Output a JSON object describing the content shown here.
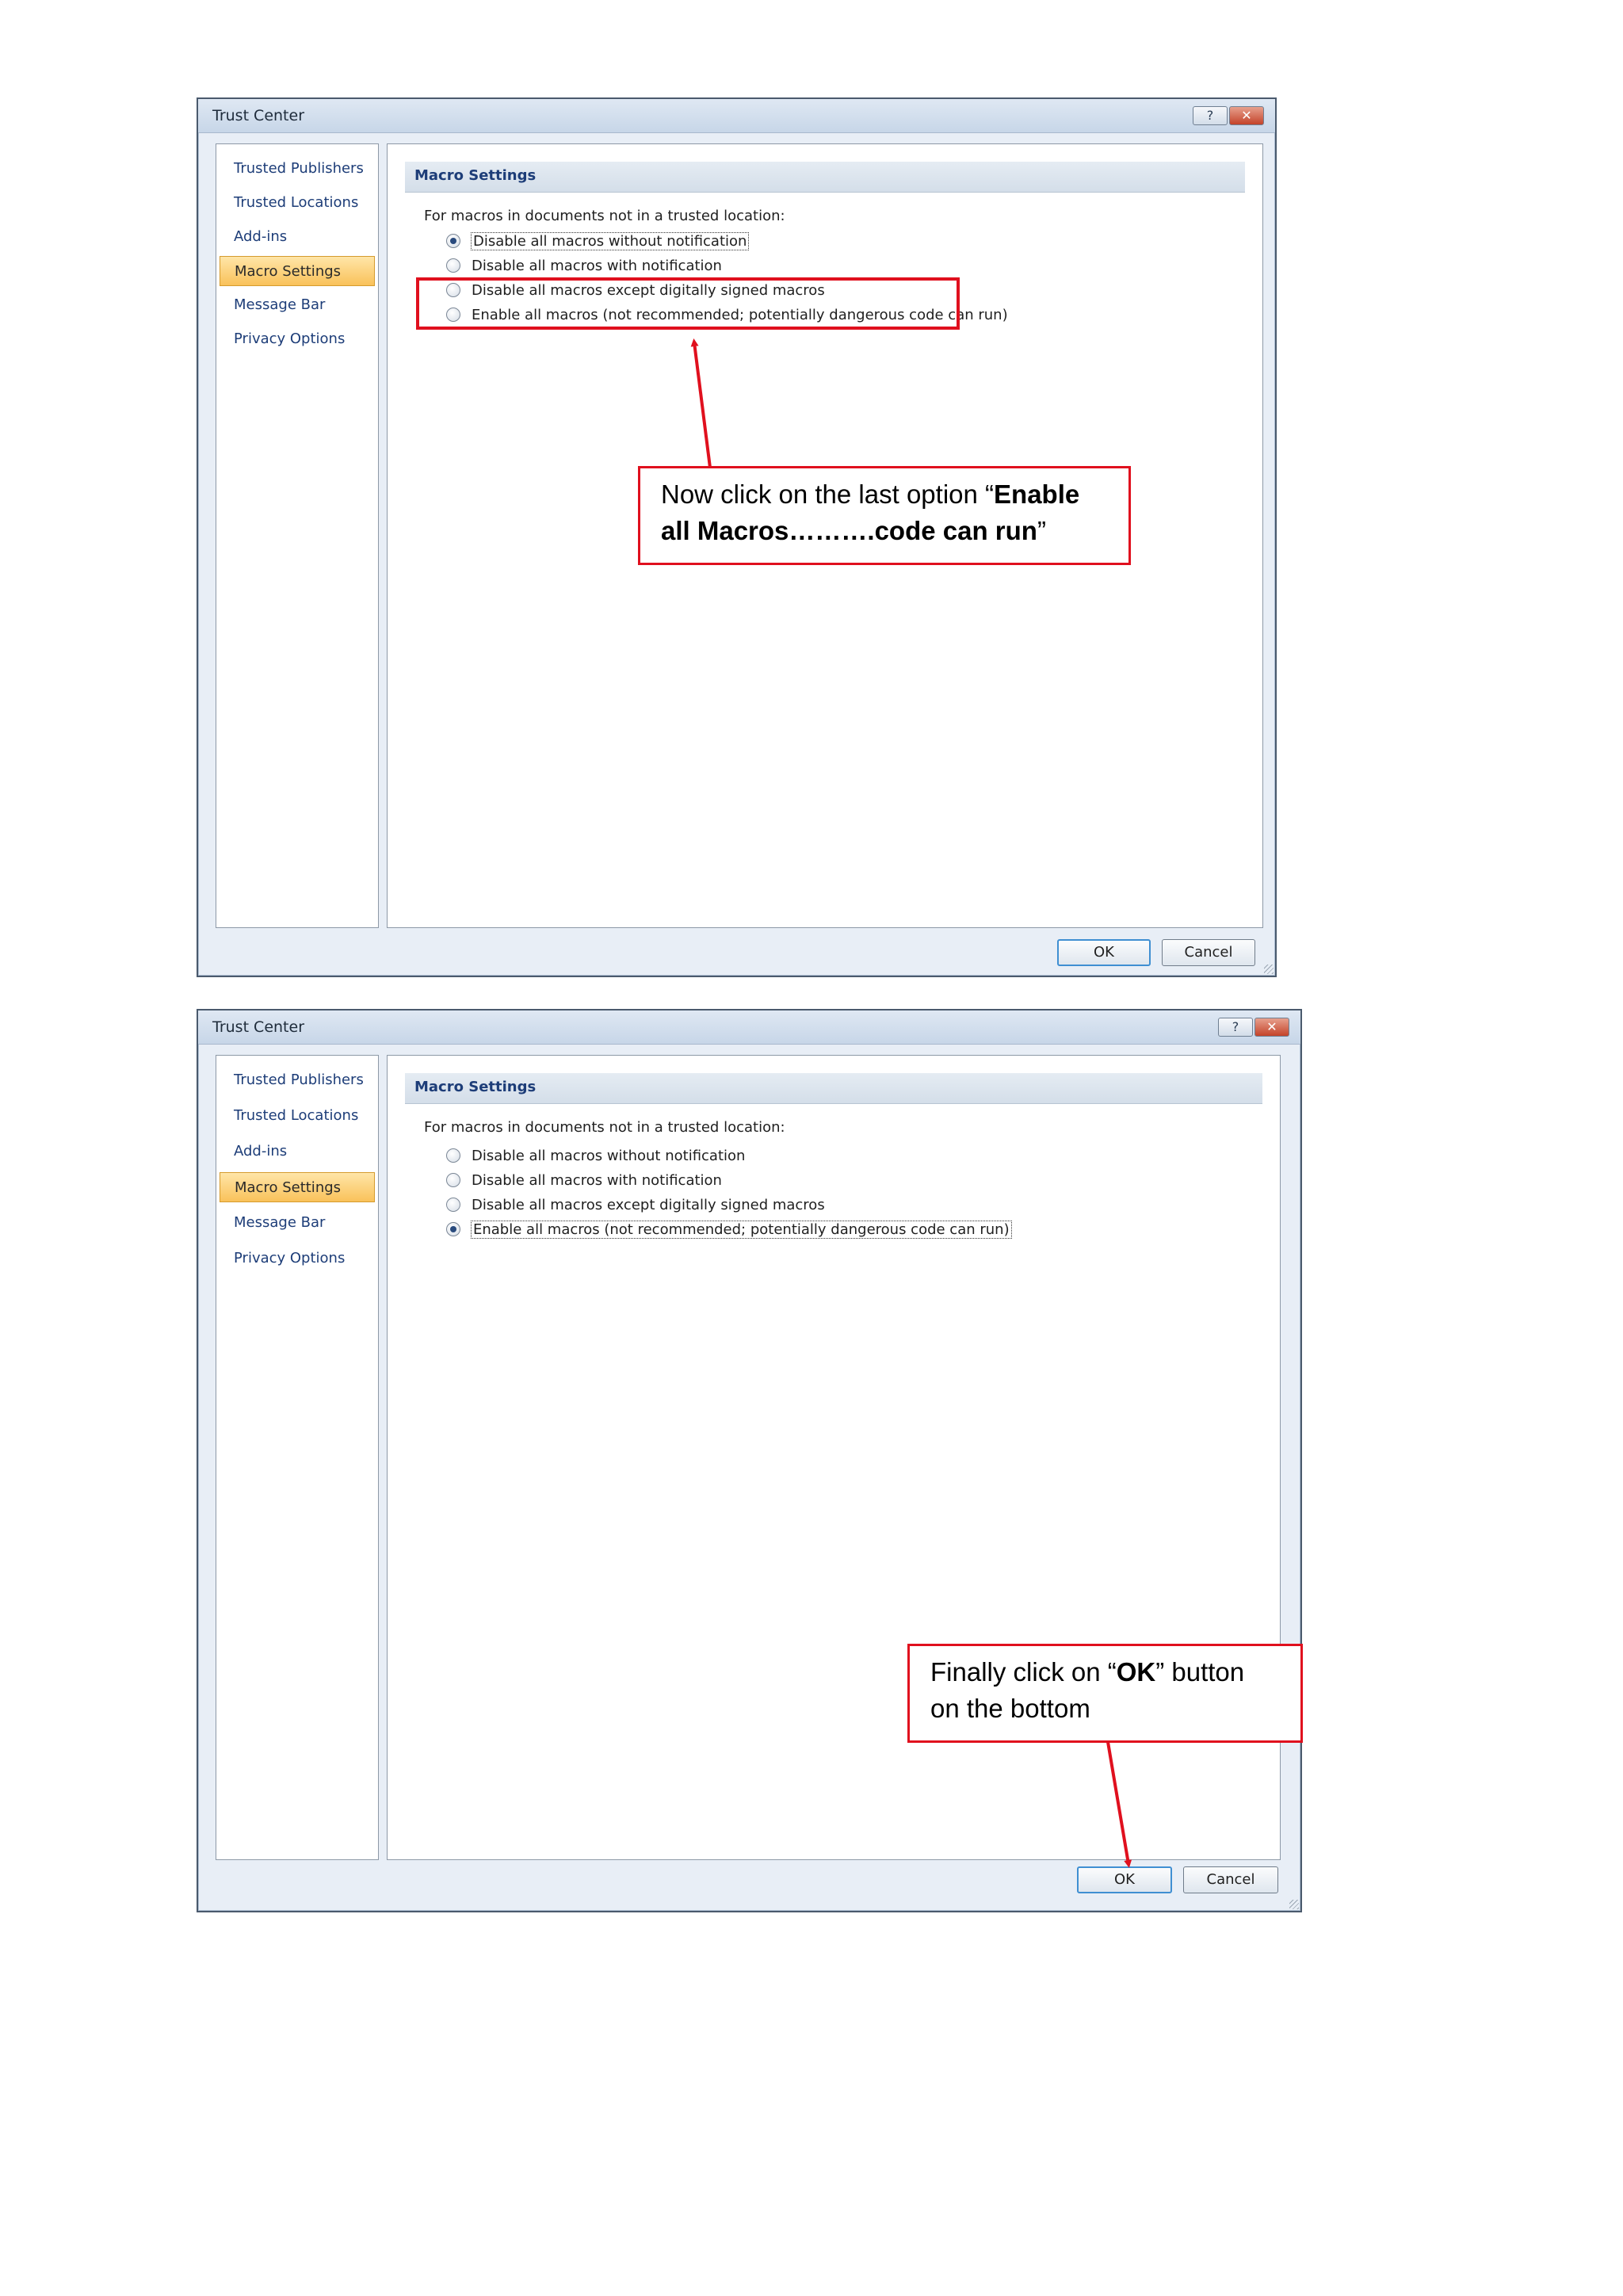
{
  "dialog1": {
    "title": "Trust Center",
    "title_buttons": {
      "help": "?",
      "close": "✕"
    },
    "nav_items": [
      {
        "label": "Trusted Publishers",
        "active": false
      },
      {
        "label": "Trusted Locations",
        "active": false
      },
      {
        "label": "Add-ins",
        "active": false
      },
      {
        "label": "Macro Settings",
        "active": true
      },
      {
        "label": "Message Bar",
        "active": false
      },
      {
        "label": "Privacy Options",
        "active": false
      }
    ],
    "section_title": "Macro Settings",
    "intro": "For macros in documents not in a trusted location:",
    "options": [
      {
        "label": "Disable all macros without notification",
        "checked": true
      },
      {
        "label": "Disable all macros with notification",
        "checked": false
      },
      {
        "label": "Disable all macros except digitally signed macros",
        "checked": false
      },
      {
        "label": "Enable all macros (not recommended; potentially dangerous code can run)",
        "checked": false
      }
    ],
    "ok_label": "OK",
    "cancel_label": "Cancel"
  },
  "dialog2": {
    "title": "Trust Center",
    "title_buttons": {
      "help": "?",
      "close": "✕"
    },
    "nav_items": [
      {
        "label": "Trusted Publishers",
        "active": false
      },
      {
        "label": "Trusted Locations",
        "active": false
      },
      {
        "label": "Add-ins",
        "active": false
      },
      {
        "label": "Macro Settings",
        "active": true
      },
      {
        "label": "Message Bar",
        "active": false
      },
      {
        "label": "Privacy Options",
        "active": false
      }
    ],
    "section_title": "Macro Settings",
    "intro": "For macros in documents not in a trusted location:",
    "options": [
      {
        "label": "Disable all macros without notification",
        "checked": false
      },
      {
        "label": "Disable all macros with notification",
        "checked": false
      },
      {
        "label": "Disable all macros except digitally signed macros",
        "checked": false
      },
      {
        "label": "Enable all macros (not recommended; potentially dangerous code can run)",
        "checked": true
      }
    ],
    "ok_label": "OK",
    "cancel_label": "Cancel"
  },
  "callout1": {
    "prefix": "Now click on the last option “",
    "bold": "Enable all Macros……….code can run",
    "suffix": "”"
  },
  "callout2": {
    "prefix": "Finally click on “",
    "bold": "OK",
    "suffix": "” button on the bottom"
  },
  "colors": {
    "annotation_red": "#e0101e",
    "nav_active": "#f9c25a",
    "nav_text": "#1d3d78"
  }
}
